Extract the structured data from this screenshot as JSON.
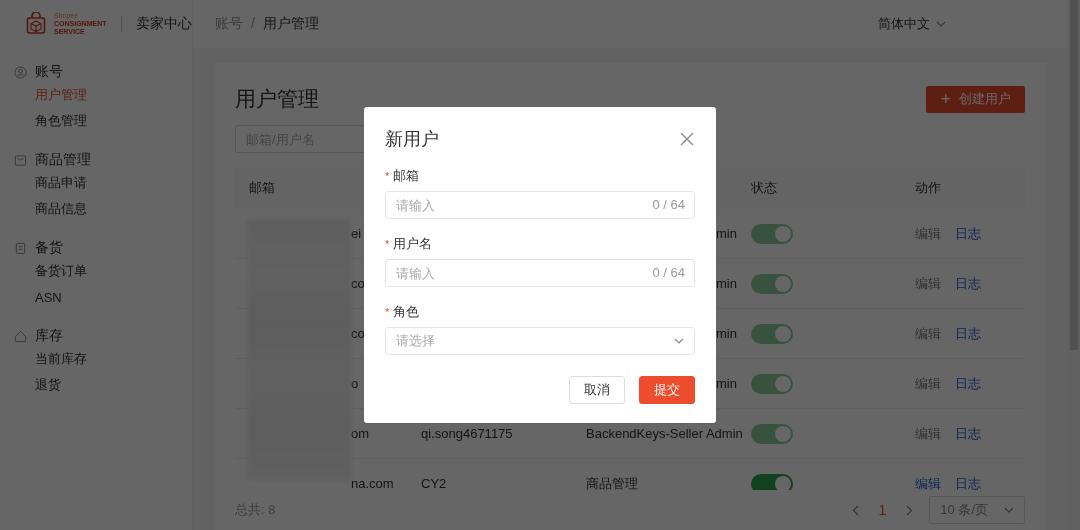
{
  "brand": {
    "lines": [
      "Shopee",
      "CONSIGNMENT",
      "SERVICE"
    ],
    "app_name": "卖家中心"
  },
  "breadcrumb": [
    "账号",
    "用户管理"
  ],
  "breadcrumb_separator": "/",
  "language": "简体中文",
  "sidebar": {
    "groups": [
      {
        "kind": "user",
        "title": "账号",
        "items": [
          {
            "label": "用户管理",
            "selected": true
          },
          {
            "label": "角色管理",
            "selected": false
          }
        ]
      },
      {
        "kind": "box",
        "title": "商品管理",
        "items": [
          {
            "label": "商品申请",
            "selected": false
          },
          {
            "label": "商品信息",
            "selected": false
          }
        ]
      },
      {
        "kind": "clipboard",
        "title": "备货",
        "items": [
          {
            "label": "备货订单",
            "selected": false
          },
          {
            "label": "ASN",
            "selected": false
          }
        ]
      },
      {
        "kind": "house",
        "title": "库存",
        "items": [
          {
            "label": "当前库存",
            "selected": false
          },
          {
            "label": "退货",
            "selected": false
          }
        ]
      }
    ]
  },
  "page": {
    "title": "用户管理",
    "create_button": {
      "icon": "+",
      "label": "创建用户"
    },
    "search": {
      "placeholder": "邮箱/用户名"
    }
  },
  "table": {
    "columns": {
      "email": "邮箱",
      "status": "状态",
      "action": "动作"
    },
    "rows": [
      {
        "email_tail": "ei",
        "role_tail": "min",
        "on": true,
        "disabled": true,
        "edit": "编辑",
        "log": "日志"
      },
      {
        "email_tail": "co",
        "role_tail": "min",
        "on": true,
        "disabled": true,
        "edit": "编辑",
        "log": "日志"
      },
      {
        "email_tail": "co",
        "role_tail": "min",
        "on": true,
        "disabled": true,
        "edit": "编辑",
        "log": "日志"
      },
      {
        "email_tail": "o",
        "role_tail": "min",
        "on": true,
        "disabled": true,
        "edit": "编辑",
        "log": "日志"
      },
      {
        "email_tail": "om",
        "username": "qi.song4671175",
        "role": "BackendKeys-Seller Admin",
        "on": true,
        "disabled": true,
        "edit": "编辑",
        "log": "日志"
      },
      {
        "email_tail": "na.com",
        "username": "CY2",
        "role": "商品管理",
        "on": true,
        "disabled": false,
        "edit": "编辑",
        "log": "日志"
      }
    ]
  },
  "footer": {
    "total": "总共: 8",
    "pages": [
      {
        "label": "1",
        "selected": true
      }
    ],
    "page_size": "10 条/页"
  },
  "dialog": {
    "title": "新用户",
    "fields": [
      {
        "kind": "text",
        "required_mark": "*",
        "label": "邮箱",
        "placeholder": "请输入",
        "counter": "0 / 64"
      },
      {
        "kind": "text",
        "required_mark": "*",
        "label": "用户名",
        "placeholder": "请输入",
        "counter": "0 / 64"
      },
      {
        "kind": "select",
        "required_mark": "*",
        "label": "角色",
        "placeholder": "请选择"
      }
    ],
    "buttons": [
      {
        "kind": "secondary",
        "label": "取消"
      },
      {
        "kind": "primary",
        "label": "提交"
      }
    ]
  }
}
